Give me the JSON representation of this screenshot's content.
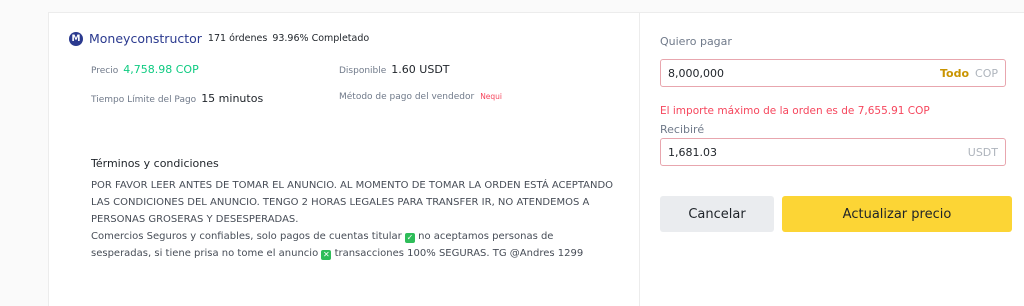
{
  "advertiser": {
    "avatar_letter": "M",
    "name": "Moneyconstructor",
    "orders": "171 órdenes",
    "completion": "93.96% Completado"
  },
  "details": {
    "price_label": "Precio",
    "price_value": "4,758.98 COP",
    "available_label": "Disponible",
    "available_value": "1.60 USDT",
    "time_limit_label": "Tiempo Límite del Pago",
    "time_limit_value": "15 minutos",
    "payment_label": "Método de pago del vendedor",
    "payment_method": "Nequi"
  },
  "terms": {
    "title": "Términos y condiciones",
    "paragraph1": "POR FAVOR LEER ANTES DE TOMAR EL ANUNCIO. AL MOMENTO DE TOMAR LA ORDEN ESTÁ ACEPTANDO LAS CONDICIONES DEL ANUNCIO. TENGO 2 HORAS LEGALES PARA TRANSFER IR, NO ATENDEMOS A PERSONAS GROSERAS Y DESESPERADAS.",
    "line2_a": "Comercios Seguros y confiables, solo pagos de cuentas titular",
    "line2_b": "no aceptamos personas de sesperadas, si tiene prisa no tome el anuncio",
    "line2_c": "transacciones 100% SEGURAS. TG @Andres 1299"
  },
  "form": {
    "pay_label": "Quiero pagar",
    "pay_value": "8,000,000",
    "pay_all": "Todo",
    "pay_currency": "COP",
    "error": "El importe máximo de la orden es de 7,655.91 COP",
    "receive_label": "Recibiré",
    "receive_value": "1,681.03",
    "receive_currency": "USDT"
  },
  "buttons": {
    "cancel": "Cancelar",
    "update": "Actualizar precio"
  },
  "colors": {
    "accent": "#fcd535",
    "price_green": "#0ecb81",
    "error_red": "#f6465d",
    "todo_gold": "#c99400"
  },
  "icons": {
    "check_1": "check-square-icon",
    "check_2": "x-square-icon"
  }
}
